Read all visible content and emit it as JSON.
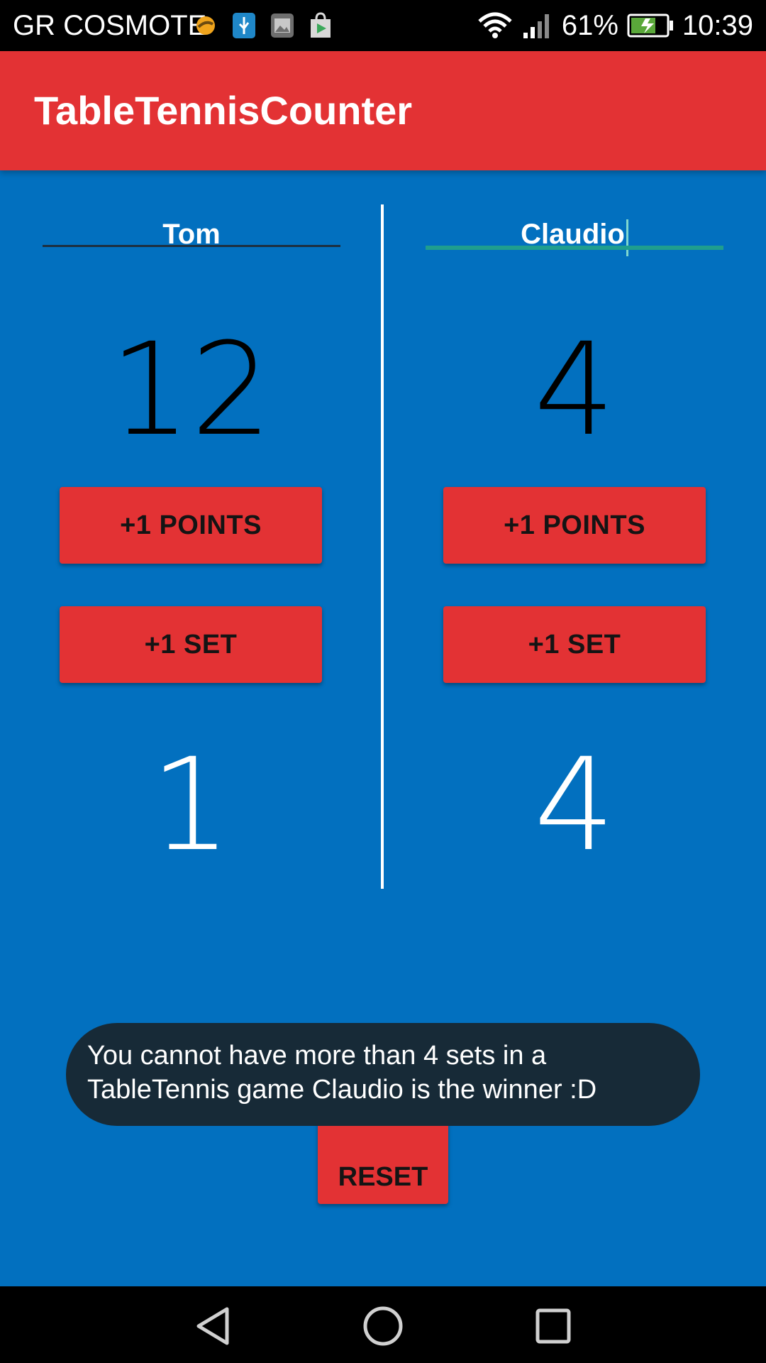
{
  "status_bar": {
    "carrier": "GR COSMOTE",
    "battery": "61%",
    "time": "10:39",
    "icons": [
      "sync-icon",
      "usb-icon",
      "gallery-icon",
      "play-store-icon",
      "wifi-icon",
      "signal-icon",
      "battery-charging-icon"
    ]
  },
  "app_bar": {
    "title": "TableTennisCounter"
  },
  "player1": {
    "name": "Tom",
    "points": "12",
    "points_button": "+1 POINTS",
    "set_button": "+1 SET",
    "sets": "1"
  },
  "player2": {
    "name": "Claudio",
    "points": "4",
    "points_button": "+1 POINTS",
    "set_button": "+1 SET",
    "sets": "4"
  },
  "reset_button": "RESET",
  "toast": {
    "message": "You cannot have more than 4 sets in a\nTableTennis game  Claudio  is the winner :D"
  },
  "nav_bar": {
    "buttons": [
      "back-icon",
      "home-icon",
      "recents-icon"
    ]
  },
  "colors": {
    "primary": "#e33234",
    "background": "#0270bf",
    "toast": "#172a37",
    "accent": "#1f9e8e"
  }
}
